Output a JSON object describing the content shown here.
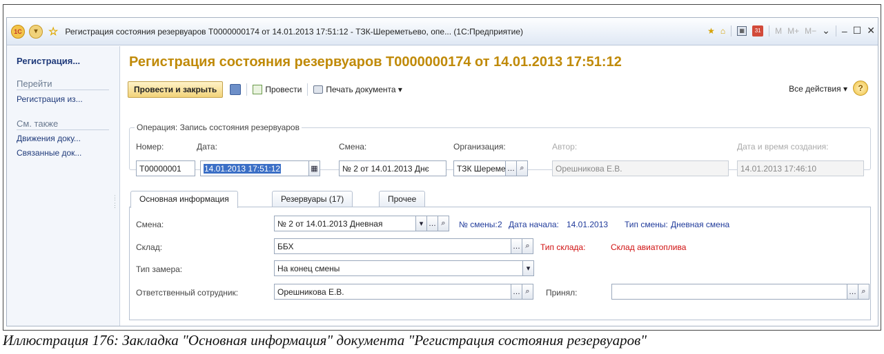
{
  "window": {
    "title": "Регистрация состояния резервуаров Т0000000174 от 14.01.2013 17:51:12 - ТЗК-Шереметьево, опе... (1С:Предприятие)",
    "right_m": "M",
    "right_mplus": "M+",
    "right_mminus": "M−",
    "calendar_day": "31"
  },
  "sidebar": {
    "title": "Регистрация...",
    "goto_header": "Перейти",
    "goto_items": [
      "Регистрация из..."
    ],
    "see_also_header": "См. также",
    "see_also_items": [
      "Движения доку...",
      "Связанные док..."
    ]
  },
  "document": {
    "title": "Регистрация состояния резервуаров Т0000000174 от 14.01.2013 17:51:12"
  },
  "toolbar": {
    "post_close": "Провести и закрыть",
    "post": "Провести",
    "print": "Печать документа ▾",
    "all_actions": "Все действия ▾",
    "help": "?"
  },
  "operation": {
    "group_title": "Операция: Запись состояния резервуаров",
    "number_label": "Номер:",
    "number_value": "Т00000001",
    "date_label": "Дата:",
    "date_value": "14.01.2013 17:51:12",
    "shift_label": "Смена:",
    "shift_value": "№ 2 от 14.01.2013 Днє",
    "org_label": "Организация:",
    "org_value": "ТЗК Шереме",
    "author_label": "Автор:",
    "author_value": "Орешникова Е.В.",
    "created_label": "Дата и время создания:",
    "created_value": "14.01.2013 17:46:10"
  },
  "tabs": [
    "Основная информация",
    "Резервуары (17)",
    "Прочее"
  ],
  "main_info": {
    "shift_label": "Смена:",
    "shift_value": "№ 2 от 14.01.2013 Дневная",
    "shift_no_label": "№ смены:",
    "shift_no": "2",
    "start_label": "Дата начала:",
    "start_value": "14.01.2013",
    "shift_type_label": "Тип смены:",
    "shift_type": "Дневная смена",
    "warehouse_label": "Склад:",
    "warehouse_value": "ББХ",
    "warehouse_type_label": "Тип склада:",
    "warehouse_type": "Склад авиатоплива",
    "measure_label": "Тип замера:",
    "measure_value": "На конец смены",
    "responsible_label": "Ответственный сотрудник:",
    "responsible_value": "Орешникова Е.В.",
    "accepted_label": "Принял:",
    "accepted_value": ""
  },
  "caption": "Иллюстрация 176: Закладка \"Основная информация\" документа \"Регистрация состояния резервуаров\""
}
